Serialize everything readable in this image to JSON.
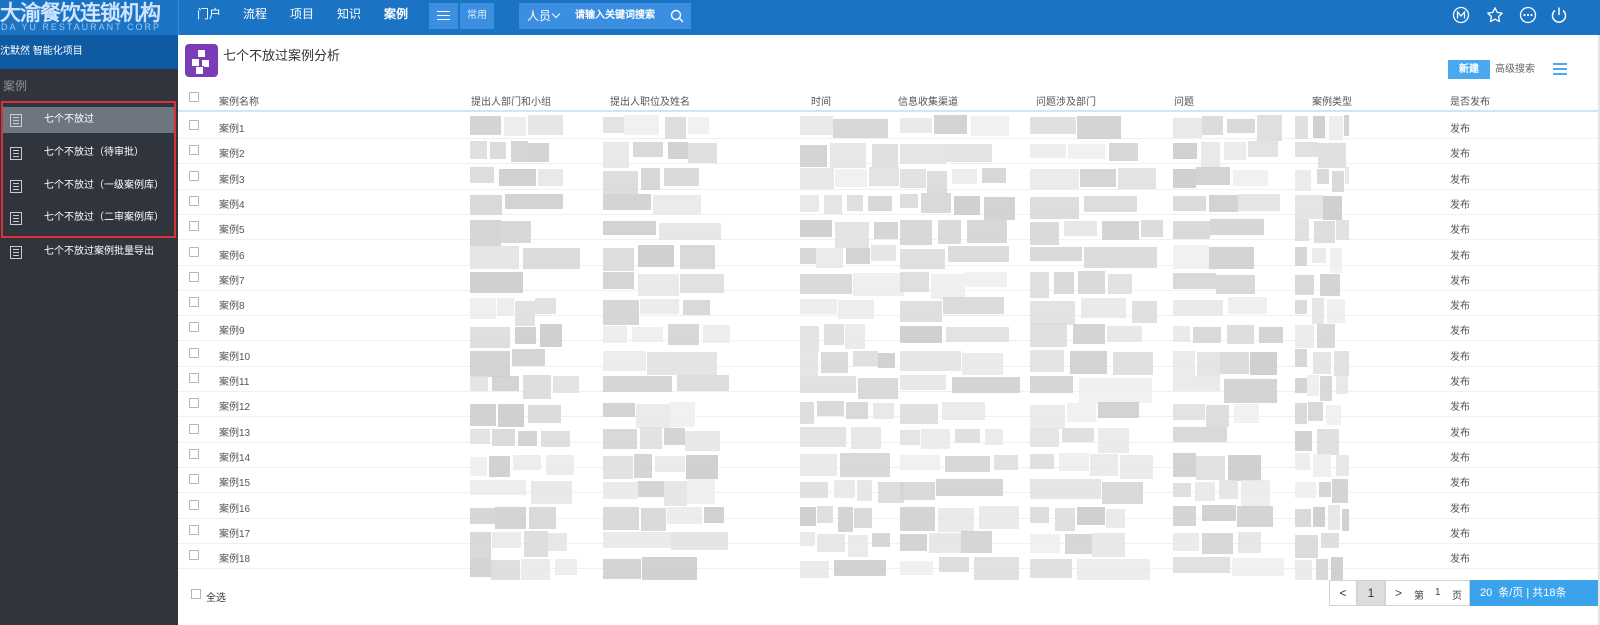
{
  "logo": {
    "cn": "大渝餐饮连锁机构",
    "en": "DA YU RESTAURANT CORP"
  },
  "topnav": [
    "门户",
    "流程",
    "项目",
    "知识",
    "案例"
  ],
  "topnav_active": 4,
  "common_label": "常用",
  "people_select": "人员",
  "search_placeholder": "请输入关键词搜索",
  "right_icons": [
    "m-circle-icon",
    "star-icon",
    "more-circle-icon",
    "power-icon"
  ],
  "sidebar": {
    "user": "沈默然 智能化项目",
    "section": "案例",
    "items": [
      {
        "label": "七个不放过",
        "active": true
      },
      {
        "label": "七个不放过（待审批）"
      },
      {
        "label": "七个不放过（一级案例库）"
      },
      {
        "label": "七个不放过（二审案例库）"
      },
      {
        "label": "七个不放过案例批量导出"
      }
    ]
  },
  "page_title": "七个不放过案例分析",
  "toolbar": {
    "new_label": "新建",
    "adv_search_label": "高级搜索"
  },
  "table": {
    "columns": [
      "案例名称",
      "提出人部门和小组",
      "提出人职位及姓名",
      "时间",
      "信息收集渠道",
      "问题涉及部门",
      "问题",
      "案例类型",
      "是否发布"
    ],
    "rows": [
      {
        "name": "案例1",
        "publish": "发布"
      },
      {
        "name": "案例2",
        "publish": "发布"
      },
      {
        "name": "案例3",
        "publish": "发布"
      },
      {
        "name": "案例4",
        "publish": "发布"
      },
      {
        "name": "案例5",
        "publish": "发布"
      },
      {
        "name": "案例6",
        "publish": "发布"
      },
      {
        "name": "案例7",
        "publish": "发布"
      },
      {
        "name": "案例8",
        "publish": "发布"
      },
      {
        "name": "案例9",
        "publish": "发布"
      },
      {
        "name": "案例10",
        "publish": "发布"
      },
      {
        "name": "案例11",
        "publish": "发布"
      },
      {
        "name": "案例12",
        "publish": "发布"
      },
      {
        "name": "案例13",
        "publish": "发布"
      },
      {
        "name": "案例14",
        "publish": "发布"
      },
      {
        "name": "案例15",
        "publish": "发布"
      },
      {
        "name": "案例16",
        "publish": "发布"
      },
      {
        "name": "案例17",
        "publish": "发布"
      },
      {
        "name": "案例18",
        "publish": "发布"
      }
    ]
  },
  "footer": {
    "select_all": "全选",
    "prev": "<",
    "current_page": "1",
    "next": ">",
    "page_prefix": "第",
    "page_value": "1",
    "page_suffix": "页",
    "per_page": "20",
    "per_page_text": "条/页 | 共18条"
  },
  "colors": {
    "topbar": "#1b73c4",
    "sidebar": "#30343d",
    "accent": "#3ba3ec",
    "highlight": "#d8323a"
  }
}
